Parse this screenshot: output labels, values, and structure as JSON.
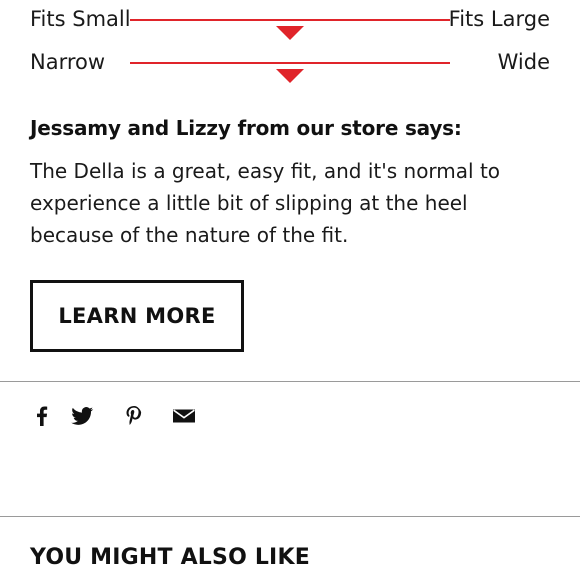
{
  "fit_scales": {
    "size": {
      "left_label": "Fits Small",
      "right_label": "Fits Large",
      "value": 0.5
    },
    "width": {
      "left_label": "Narrow",
      "right_label": "Wide",
      "value": 0.5
    }
  },
  "store_note": {
    "heading": "Jessamy and Lizzy from our store says:",
    "body": "The Della is a great, easy fit, and it's normal to experience a little bit of slipping at the heel because of the nature of the fit."
  },
  "cta": {
    "label": "LEARN MORE"
  },
  "share": {
    "icons": [
      "facebook-icon",
      "twitter-icon",
      "pinterest-icon",
      "email-icon"
    ]
  },
  "related": {
    "heading": "YOU MIGHT ALSO LIKE"
  },
  "colors": {
    "accent": "#e0242a",
    "text": "#111111",
    "divider": "#9a9a9a"
  }
}
